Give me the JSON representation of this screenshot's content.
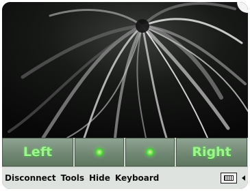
{
  "controls": {
    "left_label": "Left",
    "right_label": "Right"
  },
  "menu": {
    "disconnect": "Disconnect",
    "tools": "Tools",
    "hide": "Hide",
    "keyboard": "Keyboard"
  },
  "icons": {
    "sip": "keyboard-icon",
    "sip_arrow": "arrow-left-icon",
    "center_left": "green-dot-icon",
    "center_right": "green-dot-icon"
  },
  "colors": {
    "button_text": "#9ef58f",
    "button_bg": "#6f8672",
    "taskbar_bg": "#dfe3df",
    "screen_bg": "#0e0f0e"
  }
}
